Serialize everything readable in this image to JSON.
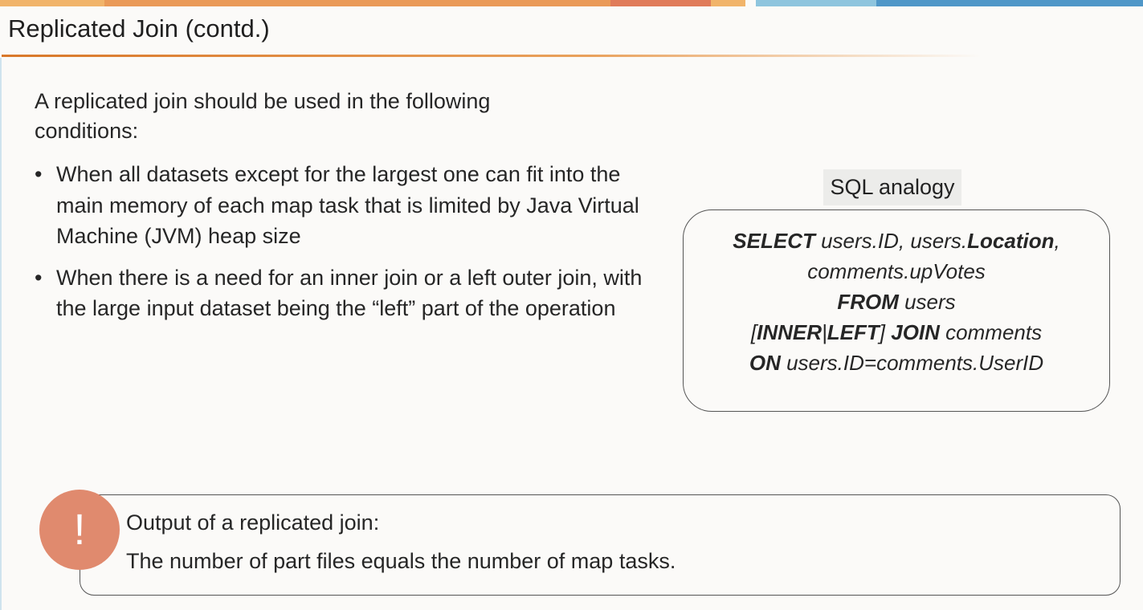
{
  "slide": {
    "title": "Replicated Join (contd.)",
    "intro": "A replicated join should be used in the following conditions:",
    "bullet_char": "•",
    "bullets": [
      "When all datasets except for the largest one can fit into the main memory of each map task that is limited by Java Virtual Machine (JVM) heap size",
      "When there is a need for an inner join or a left outer join, with the large input dataset being the “left” part of the operation"
    ]
  },
  "sql": {
    "label": "SQL analogy",
    "line1_kw1": "SELECT",
    "line1_t1": " users.ID, users.",
    "line1_kw2": "Location",
    "line1_t2": ",",
    "line2": "comments.upVotes",
    "line3_kw": "FROM",
    "line3_t": " users",
    "line4_t1": "[",
    "line4_kw1": "INNER",
    "line4_t2": "|",
    "line4_kw2": "LEFT",
    "line4_t3": "] ",
    "line4_kw3": "JOIN",
    "line4_t4": " comments",
    "line5_kw": "ON",
    "line5_t": " users.ID=comments.UserID"
  },
  "callout": {
    "icon_glyph": "!",
    "title": "Output of a replicated join:",
    "text": "The number of part files equals the number of map tasks."
  },
  "colors": {
    "accent_orange": "#e9a15c",
    "accent_red": "#e08a6e",
    "accent_blue": "#8ec5de"
  }
}
